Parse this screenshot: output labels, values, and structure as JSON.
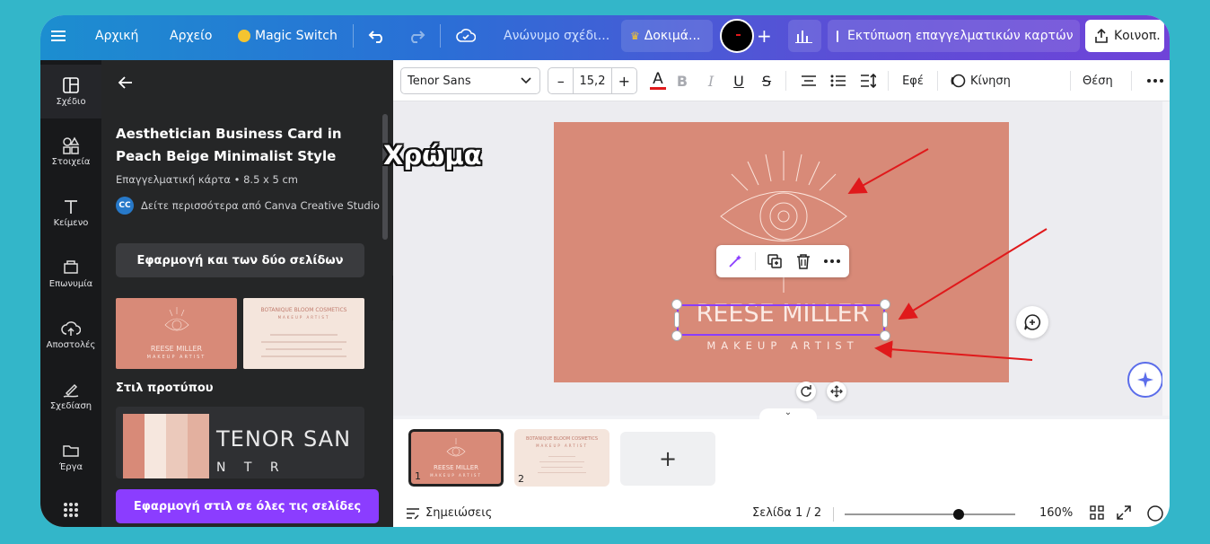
{
  "topbar": {
    "menu_icon": "hamburger-icon",
    "home": "Αρχική",
    "file": "Αρχείο",
    "magic_switch": "Magic Switch",
    "design_title": "Ανώνυμο σχέδι...",
    "trial": "Δοκιμά...",
    "print_cards": "Εκτύπωση επαγγελματικών καρτών",
    "share": "Κοινοπ."
  },
  "rail": [
    {
      "label": "Σχέδιο",
      "icon": "layout-icon"
    },
    {
      "label": "Στοιχεία",
      "icon": "shapes-icon"
    },
    {
      "label": "Κείμενο",
      "icon": "text-icon"
    },
    {
      "label": "Επωνυμία",
      "icon": "brand-icon"
    },
    {
      "label": "Αποστολές",
      "icon": "upload-icon"
    },
    {
      "label": "Σχεδίαση",
      "icon": "draw-icon"
    },
    {
      "label": "Έργα",
      "icon": "folder-icon"
    }
  ],
  "panel": {
    "title": "Aesthetician Business Card in Peach Beige Minimalist Style",
    "meta": "Επαγγελματική κάρτα • 8.5 x 5 cm",
    "creator_badge": "CC",
    "creator": "Δείτε περισσότερα από Canva Creative Studio",
    "apply_both": "Εφαρμογή και των δύο σελίδων",
    "thumb1_name": "REESE MILLER",
    "thumb1_role": "MAKEUP ARTIST",
    "thumb2_name": "BOTANIQUE BLOOM COSMETICS",
    "thumb2_role": "MAKEUP ARTIST",
    "styles_heading": "Στιλ προτύπου",
    "style_font1": "TENOR SAN",
    "style_font2": "N T R",
    "apply_all": "Εφαρμογή στιλ σε όλες τις σελίδες"
  },
  "toolbar": {
    "font": "Tenor Sans",
    "size": "15,2",
    "minus": "–",
    "plus": "+",
    "effects": "Εφέ",
    "animate": "Κίνηση",
    "position": "Θέση"
  },
  "card": {
    "name": "REESE MILLER",
    "role": "MAKEUP ARTIST"
  },
  "annotation": {
    "label": "Χρώμα"
  },
  "pages": [
    {
      "num": "1",
      "name": "REESE MILLER",
      "role": "MAKEUP ARTIST"
    },
    {
      "num": "2",
      "name": "BOTANIQUE BLOOM COSMETICS",
      "role": "MAKEUP ARTIST"
    }
  ],
  "status": {
    "notes": "Σημειώσεις",
    "page_indicator": "Σελίδα 1 / 2",
    "zoom": "160%",
    "zoom_level": 0.67
  },
  "colors": {
    "card": "#d88a78",
    "accent": "#8b3dff",
    "arrow": "#e0191b"
  }
}
